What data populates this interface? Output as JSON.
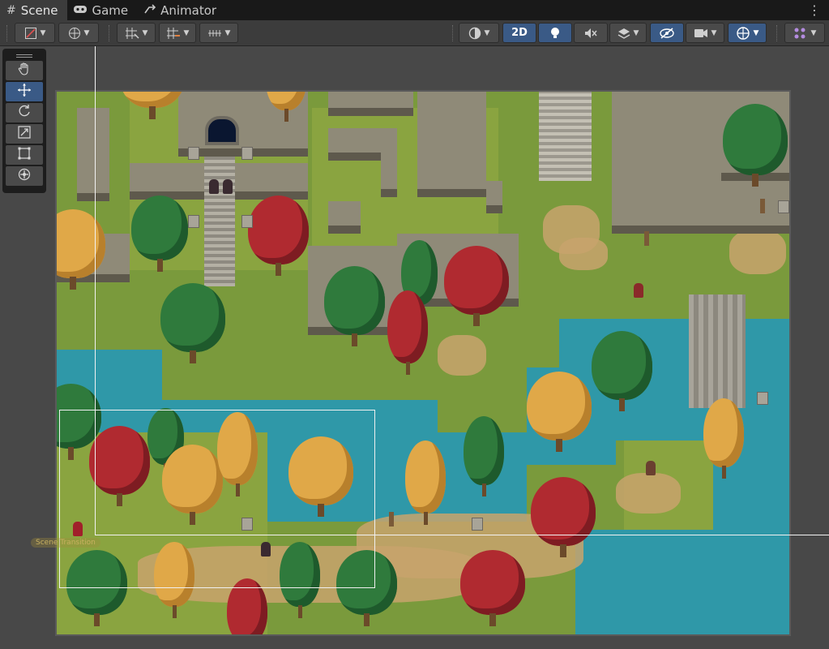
{
  "tabs": [
    {
      "label": "Scene",
      "icon": "grid-icon",
      "active": true
    },
    {
      "label": "Game",
      "icon": "gamepad-icon",
      "active": false
    },
    {
      "label": "Animator",
      "icon": "animator-icon",
      "active": false
    }
  ],
  "toolbar": {
    "view2d_label": "2D"
  },
  "scene": {
    "overlay_label": "Scene Transition"
  },
  "tools": [
    "hand-tool",
    "move-tool",
    "rotate-tool",
    "scale-tool",
    "rect-tool",
    "transform-tool"
  ],
  "colors": {
    "accent": "#3a5a86",
    "grass": "#7a9a3c",
    "water": "#2f98a8"
  }
}
